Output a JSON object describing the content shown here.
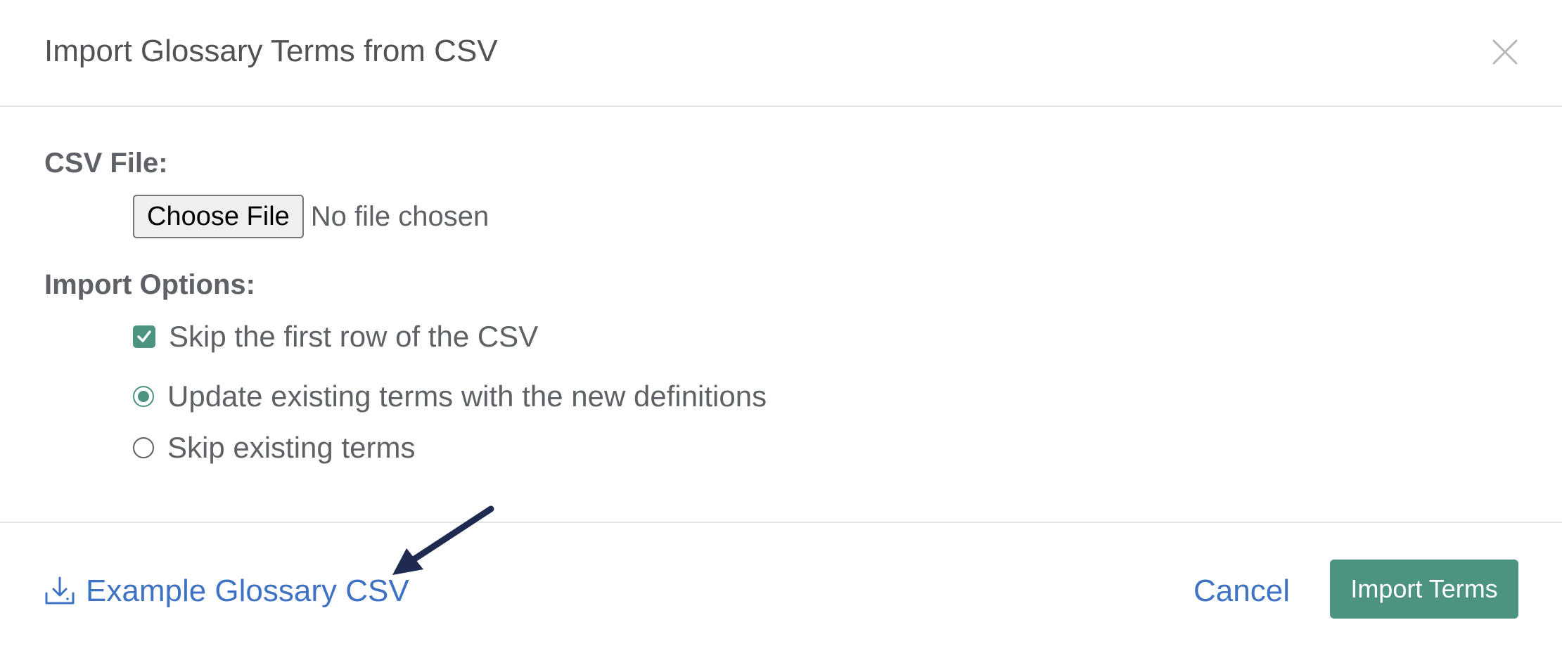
{
  "dialog": {
    "title": "Import Glossary Terms from CSV",
    "close_icon": "close-icon"
  },
  "csv_file": {
    "label": "CSV File:",
    "choose_file_label": "Choose File",
    "file_status": "No file chosen"
  },
  "import_options": {
    "label": "Import Options:",
    "skip_first_row": {
      "label": "Skip the first row of the CSV",
      "checked": true
    },
    "existing_terms": {
      "selected": "update",
      "options": [
        {
          "value": "update",
          "label": "Update existing terms with the new definitions"
        },
        {
          "value": "skip",
          "label": "Skip existing terms"
        }
      ]
    }
  },
  "footer": {
    "example_link_label": "Example Glossary CSV",
    "example_link_icon": "download-icon",
    "cancel_label": "Cancel",
    "import_label": "Import Terms"
  },
  "colors": {
    "accent": "#4c9382",
    "link": "#3e72c4",
    "text": "#5e6166",
    "annotation_arrow": "#1e2a50"
  }
}
